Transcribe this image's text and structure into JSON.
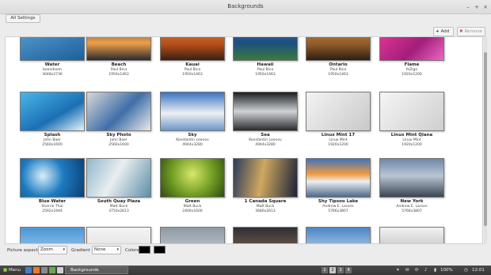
{
  "window": {
    "title": "Backgrounds",
    "minimize": "–",
    "maximize": "+",
    "close": "×"
  },
  "toolbar": {
    "all_settings": "All Settings",
    "add_glyph": "+",
    "add": "Add",
    "remove_glyph": "✖",
    "remove": "Remove"
  },
  "wallpapers": [
    {
      "title": "Water",
      "author": "boondoom",
      "size": "3648x2736",
      "bg": "linear-gradient(160deg,#5ea3d8,#1d5f9a)"
    },
    {
      "title": "Beach",
      "author": "Paul Bica",
      "size": "1950x1463",
      "bg": "linear-gradient(#2a3a55,#f0a048 55%,#2b2b30)"
    },
    {
      "title": "Kauai",
      "author": "Paul Bica",
      "size": "1950x1463",
      "bg": "linear-gradient(#e08a2e,#b34c1a 60%,#3a2012)"
    },
    {
      "title": "Hawaii",
      "author": "Paul Bica",
      "size": "1950x1463",
      "bg": "linear-gradient(#2f6ab5,#1e4f80 55%,#3b7a3b)"
    },
    {
      "title": "Ontario",
      "author": "Paul Bica",
      "size": "1950x1463",
      "bg": "linear-gradient(#d98a3a,#8c5a2a 60%,#2e1e12)"
    },
    {
      "title": "Flame",
      "author": "feZigo",
      "size": "1920x1200",
      "bg": "linear-gradient(135deg,#f03a9a,#a31d7a 60%,#e86ac0)"
    },
    {
      "title": "Splash",
      "author": "John Baer",
      "size": "2560x1600",
      "bg": "linear-gradient(150deg,#49b6e8,#1b6fb4 60%,#e6f4fa)"
    },
    {
      "title": "Sky Photo",
      "author": "John Baer",
      "size": "2560x1600",
      "bg": "linear-gradient(135deg,#d8d8d8,#3f6fa8 55%,#eaeaea)"
    },
    {
      "title": "Sky",
      "author": "Konstantin Leonov",
      "size": "4944x3280",
      "bg": "linear-gradient(#3a74c2,#eef0f3 55%,#6d96c9)"
    },
    {
      "title": "Sea",
      "author": "Konstantin Leonov",
      "size": "4944x3280",
      "bg": "linear-gradient(#1c1c1e,#cfd3d6 50%,#2a2a2c)"
    },
    {
      "title": "Linux Mint 17",
      "author": "Linux Mint",
      "size": "1920x1200",
      "bg": "linear-gradient(135deg,#f3f3f3,#c9c9c9)"
    },
    {
      "title": "Linux Mint Qiana",
      "author": "Linux Mint",
      "size": "1920x1200",
      "bg": "linear-gradient(135deg,#f5f5f5,#cfcfcf)"
    },
    {
      "title": "Blue Water",
      "author": "Sherrie Thai",
      "size": "2592x1944",
      "bg": "radial-gradient(circle at 35% 45%,#d9eefa,#1d7bc0 45%,#0c3f73)"
    },
    {
      "title": "South Quay Plaza",
      "author": "Matt Buck",
      "size": "3750x2613",
      "bg": "linear-gradient(120deg,#8fb7cc,#e9eef0 45%,#5d8ea6)"
    },
    {
      "title": "Green",
      "author": "Matt Buck",
      "size": "2400x1600",
      "bg": "radial-gradient(circle at 50% 40%,#d7e86a,#6f9a22 55%,#2f4a12)"
    },
    {
      "title": "1 Canada Square",
      "author": "Matt Buck",
      "size": "3680x2613",
      "bg": "linear-gradient(100deg,#2b3a5c,#d0a860 45%,#1a2238)"
    },
    {
      "title": "Shy Tipsoo Lake",
      "author": "Andrew E. Larsen",
      "size": "5766x3807",
      "bg": "linear-gradient(#3f74bd,#f09a40 40%,#eaeef2 60%,#4e6a8a)"
    },
    {
      "title": "New York",
      "author": "Andrew E. Larsen",
      "size": "5766x3807",
      "bg": "linear-gradient(#6f87a8,#b9c6d4 45%,#3a4550)"
    },
    {
      "title": "",
      "author": "",
      "size": "",
      "bg": "linear-gradient(#4c95d6,#bfe0f2)"
    },
    {
      "title": "",
      "author": "",
      "size": "",
      "bg": "linear-gradient(#f4f4f4,#d6d6d6)"
    },
    {
      "title": "",
      "author": "",
      "size": "",
      "bg": "linear-gradient(#8e9aa4,#d9dde0)"
    },
    {
      "title": "",
      "author": "",
      "size": "",
      "bg": "linear-gradient(#2f2f34,#9a7a5a)"
    },
    {
      "title": "",
      "author": "",
      "size": "",
      "bg": "linear-gradient(#4a86c6,#f2f4f6)"
    },
    {
      "title": "",
      "author": "",
      "size": "",
      "bg": "linear-gradient(#f2f2f2,#a6a6a6)"
    }
  ],
  "options": {
    "aspect_label": "Picture aspect",
    "aspect_value": "Zoom",
    "gradient_label": "Gradient",
    "gradient_value": "None",
    "colors_label": "Colors",
    "arrow": "▾"
  },
  "panel": {
    "menu": "Menu",
    "task": "Backgrounds",
    "workspaces": [
      "1",
      "2",
      "3",
      "4"
    ],
    "battery": "100%",
    "time": "12:01"
  }
}
